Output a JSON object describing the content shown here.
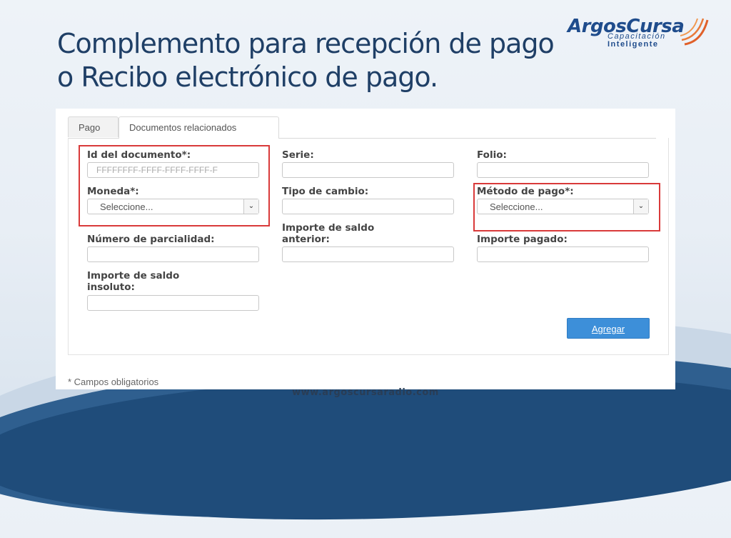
{
  "slide": {
    "title_line1": "Complemento para recepción de pago",
    "title_line2": "o Recibo electrónico de pago.",
    "footer": "www.argoscursaradio.com"
  },
  "logo": {
    "brand": "ArgosCursa",
    "sub1": "Capacitación",
    "sub2": "Inteligente"
  },
  "tabs": [
    {
      "label": "Pago",
      "active": false
    },
    {
      "label": "Documentos relacionados",
      "active": true
    }
  ],
  "form": {
    "id_documento": {
      "label": "Id del documento*:",
      "placeholder": "FFFFFFFF-FFFF-FFFF-FFFF-F"
    },
    "serie": {
      "label": "Serie:",
      "value": ""
    },
    "folio": {
      "label": "Folio:",
      "value": ""
    },
    "moneda": {
      "label": "Moneda*:",
      "selected": "Seleccione..."
    },
    "tipo_cambio": {
      "label": "Tipo de cambio:",
      "value": ""
    },
    "metodo_pago": {
      "label": "Método de pago*:",
      "selected": "Seleccione..."
    },
    "num_parcialidad": {
      "label": "Número de parcialidad:",
      "value": ""
    },
    "saldo_anterior": {
      "label_line1": "Importe de saldo",
      "label_line2": "anterior:",
      "value": ""
    },
    "importe_pagado": {
      "label": "Importe pagado:",
      "value": ""
    },
    "saldo_insoluto": {
      "label_line1": "Importe de saldo",
      "label_line2": "insoluto:",
      "value": ""
    },
    "add_button": "Agregar",
    "required_note": "* Campos obligatorios"
  },
  "colors": {
    "title": "#1f3f66",
    "highlight": "#d93a3a",
    "button": "#3d8fd9"
  }
}
